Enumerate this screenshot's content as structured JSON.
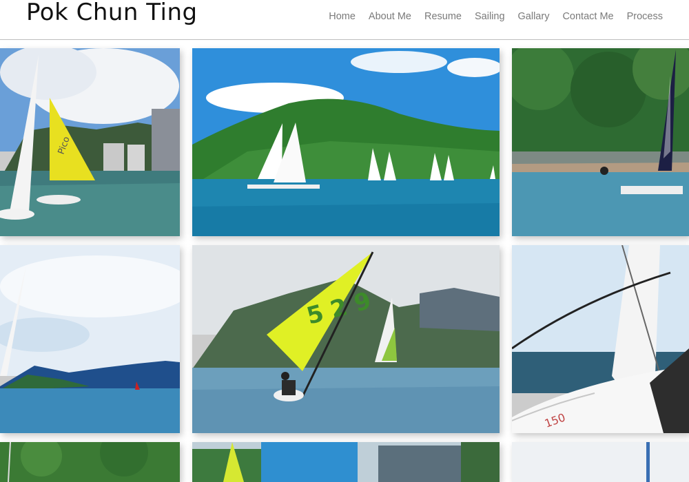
{
  "site": {
    "title": "Pok Chun Ting"
  },
  "nav": {
    "items": [
      {
        "label": "Home"
      },
      {
        "label": "About Me"
      },
      {
        "label": "Resume"
      },
      {
        "label": "Sailing"
      },
      {
        "label": "Gallary"
      },
      {
        "label": "Contact Me"
      },
      {
        "label": "Process"
      }
    ]
  },
  "gallery": {
    "photos": [
      {
        "subject": "yellow-sail-dinghy-near-city",
        "sail_text": "Pico"
      },
      {
        "subject": "fleet-of-white-dinghies-green-hill"
      },
      {
        "subject": "dark-sail-catamaran-rocky-shore"
      },
      {
        "subject": "white-sail-bay-blue-mountains"
      },
      {
        "subject": "lime-sail-dinghy-racing",
        "sail_text": "5 2 9"
      },
      {
        "subject": "onboard-view-white-sail",
        "hull_text": "150"
      },
      {
        "subject": "green-hillside-masts"
      },
      {
        "subject": "harbour-colourful-sails"
      },
      {
        "subject": "mast-against-pale-sky"
      }
    ]
  }
}
